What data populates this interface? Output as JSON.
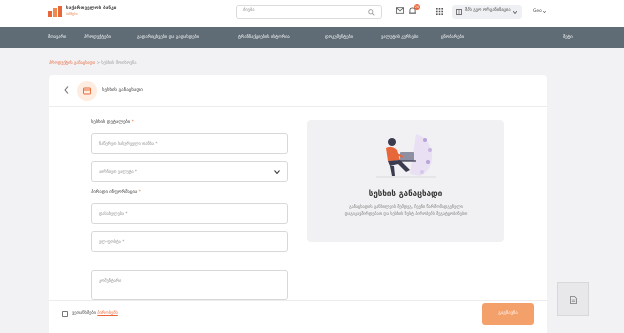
{
  "header": {
    "logo_title": "საქართველოს ბანკი",
    "logo_sub": "ბიზნესი",
    "search_placeholder": "ძიება",
    "notification_count": "20",
    "profile_name": "შპს გეო ორგანიზაცია",
    "language": "Geo"
  },
  "nav": {
    "items": [
      {
        "label": "მთავარი"
      },
      {
        "label": "პროდუქტები"
      },
      {
        "label": "გადარიცხვები და გადახდები"
      },
      {
        "label": "ტრანზაქციების ისტორია"
      },
      {
        "label": "დოკუმენტები"
      },
      {
        "label": "ვალუტის კურსები"
      },
      {
        "label": "ცნობარები"
      }
    ],
    "right_label": "მეტი"
  },
  "breadcrumb": {
    "link": "პროდუქტის განაცხადი",
    "separator": ">",
    "current": "სესხის მოთხოვნა"
  },
  "card": {
    "title": "სესხის განაცხადი",
    "section_loan": "სესხის დეტალები",
    "field_amount_ph": "ჩაწერეთ სასურველი თანხა *",
    "field_currency_ph": "აირჩიეთ ვალუტა *",
    "section_contact": "პირადი ინფორმაცია",
    "field_name_ph": "დასახელება *",
    "field_phone_ph": "ელ-ფოსტა *",
    "field_comment_ph": "კომენტარი",
    "info_title": "სესხის განაცხადი",
    "info_desc": "განაცხადის განხილვის შემდეგ, ჩვენი წარმომადგენელი დაგიკავშირდებათ და სესხის ზუსტ პირობებს შეგატყობინებთ"
  },
  "footer": {
    "agree_prefix": "ვეთანხმები",
    "agree_link": "პირობებს",
    "submit": "გაგზავნა"
  },
  "colors": {
    "accent": "#e8673a",
    "nav_bg": "#5f6c75",
    "submit_bg": "#f4a06b"
  }
}
